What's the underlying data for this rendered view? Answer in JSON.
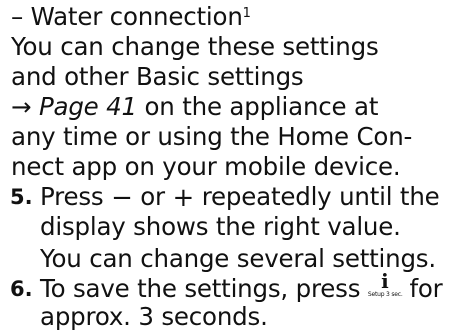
{
  "bullet": {
    "dash": "–",
    "text": "Water connection",
    "footnote": "1"
  },
  "paragraph": {
    "l1": "You can change these settings",
    "l2": "and other Basic settings",
    "l3_arrow": "→",
    "l3_ref": "Page 41",
    "l3_rest": " on the appliance at",
    "l4": "any time or using the Home Con-",
    "l5": "nect app on your mobile device."
  },
  "step5": {
    "number": "5.",
    "press": "Press ",
    "minus_symbol": "−",
    "or": " or ",
    "plus_symbol": "+",
    "rest": " repeatedly until the",
    "line2": "display shows the right value.",
    "result": "You can change several settings."
  },
  "step6": {
    "number": "6.",
    "text_before": "To save the settings, press ",
    "button_glyph": "i",
    "button_caption": "Setup 3 sec.",
    "text_after": " for",
    "line2": "approx. 3 seconds."
  },
  "icons": {
    "minus": "minus-icon",
    "plus": "plus-icon",
    "info_button": "info-setup-button-icon"
  }
}
